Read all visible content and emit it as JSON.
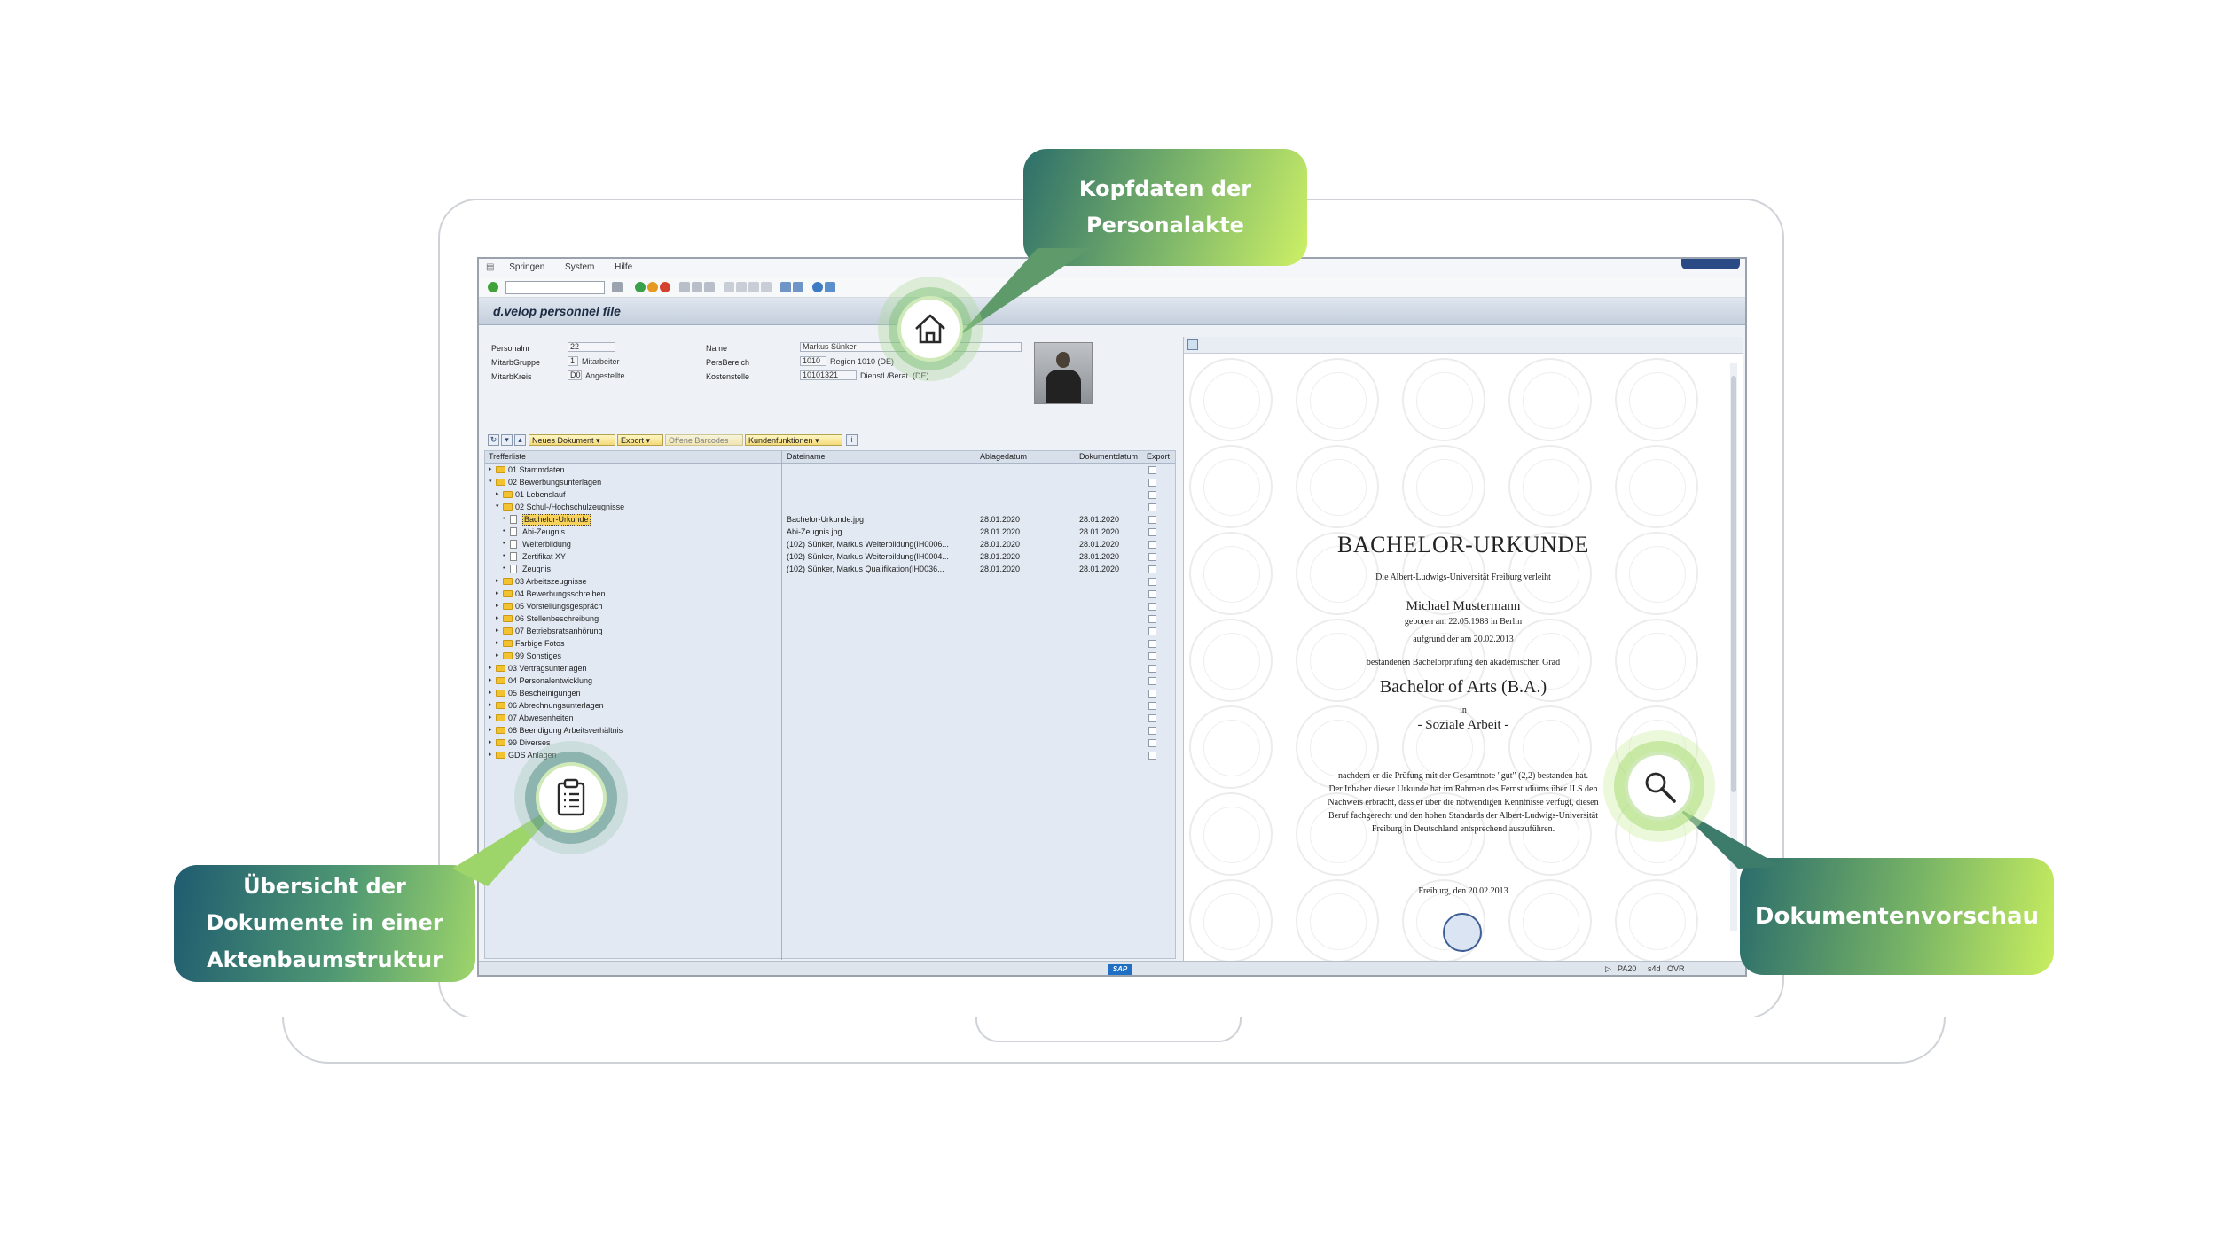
{
  "sap": {
    "menu": [
      "Springen",
      "System",
      "Hilfe"
    ],
    "app_title": "d.velop personnel file",
    "header": {
      "personalnr_label": "Personalnr",
      "personalnr_value": "22",
      "mitarbgruppe_label": "MitarbGruppe",
      "mitarbgruppe_code": "1",
      "mitarbgruppe_text": "Mitarbeiter",
      "mitarbkreis_label": "MitarbKreis",
      "mitarbkreis_code": "D0",
      "mitarbkreis_text": "Angestellte",
      "name_label": "Name",
      "name_value": "Markus Sünker",
      "persbereich_label": "PersBereich",
      "persbereich_code": "1010",
      "persbereich_text": "Region 1010 (DE)",
      "kostenstelle_label": "Kostenstelle",
      "kostenstelle_code": "10101321",
      "kostenstelle_text": "Dienstl./Berat. (DE)"
    },
    "toolbar": {
      "neues_dokument": "Neues Dokument",
      "export": "Export",
      "offene_barcodes": "Offene Barcodes",
      "kundenfunktionen": "Kundenfunktionen"
    },
    "columns": {
      "trefferliste": "Trefferliste",
      "dateiname": "Dateiname",
      "ablagedatum": "Ablagedatum",
      "dokumentdatum": "Dokumentdatum",
      "export": "Export"
    },
    "tree": [
      {
        "label": "01 Stammdaten",
        "level": 0,
        "kind": "folder",
        "open": false
      },
      {
        "label": "02 Bewerbungsunterlagen",
        "level": 0,
        "kind": "folder",
        "open": true
      },
      {
        "label": "01 Lebenslauf",
        "level": 1,
        "kind": "folder",
        "open": false
      },
      {
        "label": "02 Schul-/Hochschulzeugnisse",
        "level": 1,
        "kind": "folder",
        "open": true
      },
      {
        "label": "Bachelor-Urkunde",
        "level": 2,
        "kind": "doc",
        "selected": true,
        "file": "Bachelor-Urkunde.jpg",
        "ablage": "28.01.2020",
        "dokument": "28.01.2020"
      },
      {
        "label": "Abi-Zeugnis",
        "level": 2,
        "kind": "doc",
        "file": "Abi-Zeugnis.jpg",
        "ablage": "28.01.2020",
        "dokument": "28.01.2020"
      },
      {
        "label": "Weiterbildung",
        "level": 2,
        "kind": "doc",
        "file": "(102) Sünker, Markus Weiterbildung(IH0006...",
        "ablage": "28.01.2020",
        "dokument": "28.01.2020"
      },
      {
        "label": "Zertifikat XY",
        "level": 2,
        "kind": "doc",
        "file": "(102) Sünker, Markus Weiterbildung(IH0004...",
        "ablage": "28.01.2020",
        "dokument": "28.01.2020"
      },
      {
        "label": "Zeugnis",
        "level": 2,
        "kind": "doc",
        "file": "(102) Sünker, Markus Qualifikation(IH0036...",
        "ablage": "28.01.2020",
        "dokument": "28.01.2020"
      },
      {
        "label": "03 Arbeitszeugnisse",
        "level": 1,
        "kind": "folder",
        "open": false
      },
      {
        "label": "04 Bewerbungsschreiben",
        "level": 1,
        "kind": "folder",
        "open": false
      },
      {
        "label": "05 Vorstellungsgespräch",
        "level": 1,
        "kind": "folder",
        "open": false
      },
      {
        "label": "06 Stellenbeschreibung",
        "level": 1,
        "kind": "folder",
        "open": false
      },
      {
        "label": "07 Betriebsratsanhörung",
        "level": 1,
        "kind": "folder",
        "open": false
      },
      {
        "label": "Farbige Fotos",
        "level": 1,
        "kind": "folder",
        "open": false
      },
      {
        "label": "99 Sonstiges",
        "level": 1,
        "kind": "folder",
        "open": false
      },
      {
        "label": "03 Vertragsunterlagen",
        "level": 0,
        "kind": "folder",
        "open": false
      },
      {
        "label": "04 Personalentwicklung",
        "level": 0,
        "kind": "folder",
        "open": false
      },
      {
        "label": "05 Bescheinigungen",
        "level": 0,
        "kind": "folder",
        "open": false
      },
      {
        "label": "06 Abrechnungsunterlagen",
        "level": 0,
        "kind": "folder",
        "open": false
      },
      {
        "label": "07 Abwesenheiten",
        "level": 0,
        "kind": "folder",
        "open": false
      },
      {
        "label": "08 Beendigung Arbeitsverhältnis",
        "level": 0,
        "kind": "folder",
        "open": false
      },
      {
        "label": "99 Diverses",
        "level": 0,
        "kind": "folder",
        "open": false
      },
      {
        "label": "GDS Anlagen",
        "level": 0,
        "kind": "folder",
        "open": false
      }
    ],
    "status": {
      "transaction": "PA20",
      "client": "s4d",
      "mode": "OVR"
    }
  },
  "certificate": {
    "title": "BACHELOR-URKUNDE",
    "line1": "Die Albert-Ludwigs-Universität Freiburg verleiht",
    "name": "Michael Mustermann",
    "born": "geboren am 22.05.1988 in Berlin",
    "line2": "aufgrund der am 20.02.2013",
    "line3": "bestandenen Bachelorprüfung den akademischen Grad",
    "degree": "Bachelor of Arts (B.A.)",
    "in": "in",
    "subject": "- Soziale Arbeit -",
    "body1": "nachdem er die Prüfung mit der Gesamtnote \"gut\" (2,2) bestanden hat.",
    "body2": "Der Inhaber dieser Urkunde hat im Rahmen des Fernstudiums über ILS den",
    "body3": "Nachweis erbracht, dass er über die notwendigen Kenntnisse verfügt, diesen",
    "body4": "Beruf fachgerecht und den hohen Standards der Albert-Ludwigs-Universität",
    "body5": "Freiburg in Deutschland entsprechend auszuführen.",
    "place_date": "Freiburg, den 20.02.2013"
  },
  "callouts": {
    "header": "Kopfdaten der\nPersonalakte",
    "tree": "Übersicht der\nDokumente in einer\nAktenbaumstruktur",
    "preview": "Dokumentenvorschau"
  },
  "icons": {
    "header_badge": "home-icon",
    "tree_badge": "clipboard-icon",
    "preview_badge": "magnifier-icon"
  },
  "colors": {
    "callout_dark": "#2d6e6a",
    "callout_light": "#cdf066",
    "sap_title_text": "#1c2c44",
    "selection": "#f8d35b"
  }
}
